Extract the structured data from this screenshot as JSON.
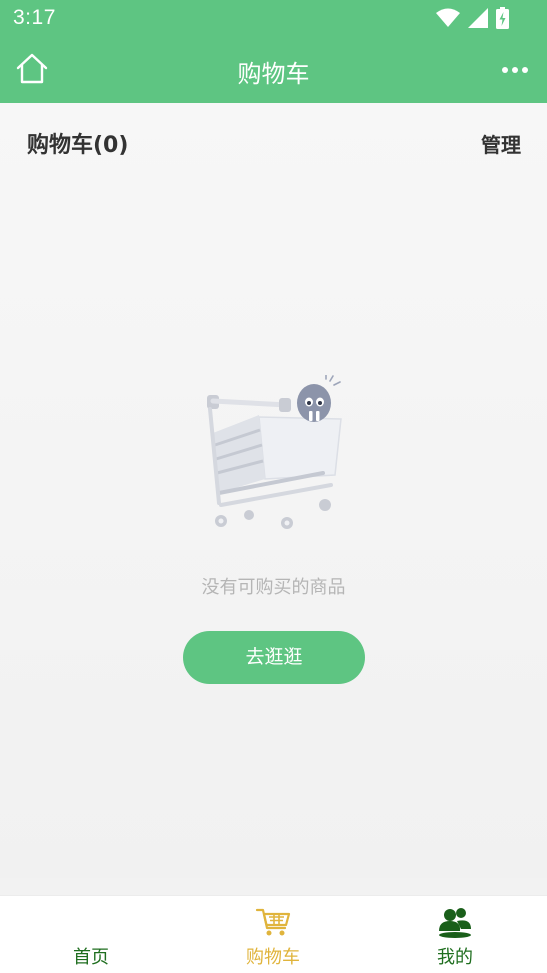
{
  "status_bar": {
    "time": "3:17",
    "icons": [
      "wifi-icon",
      "signal-icon",
      "battery-charging-icon"
    ]
  },
  "nav": {
    "title": "购物车",
    "home_icon": "home-icon",
    "more_icon": "more-dots-icon"
  },
  "cart": {
    "title": "购物车(0)",
    "manage_label": "管理",
    "empty_text": "没有可购买的商品",
    "shop_button_label": "去逛逛",
    "illustration_icon": "empty-cart-icon"
  },
  "tabbar": {
    "tabs": [
      {
        "label": "首页",
        "icon": "home-tab-icon",
        "active": false
      },
      {
        "label": "购物车",
        "icon": "cart-icon",
        "active": true
      },
      {
        "label": "我的",
        "icon": "user-group-icon",
        "active": false
      }
    ]
  },
  "colors": {
    "brand": "#5ec582",
    "active_tab": "#e0b43c",
    "inactive_tab": "#1f6e1f",
    "text_dark": "#333333",
    "text_muted": "#b5b5b5"
  }
}
